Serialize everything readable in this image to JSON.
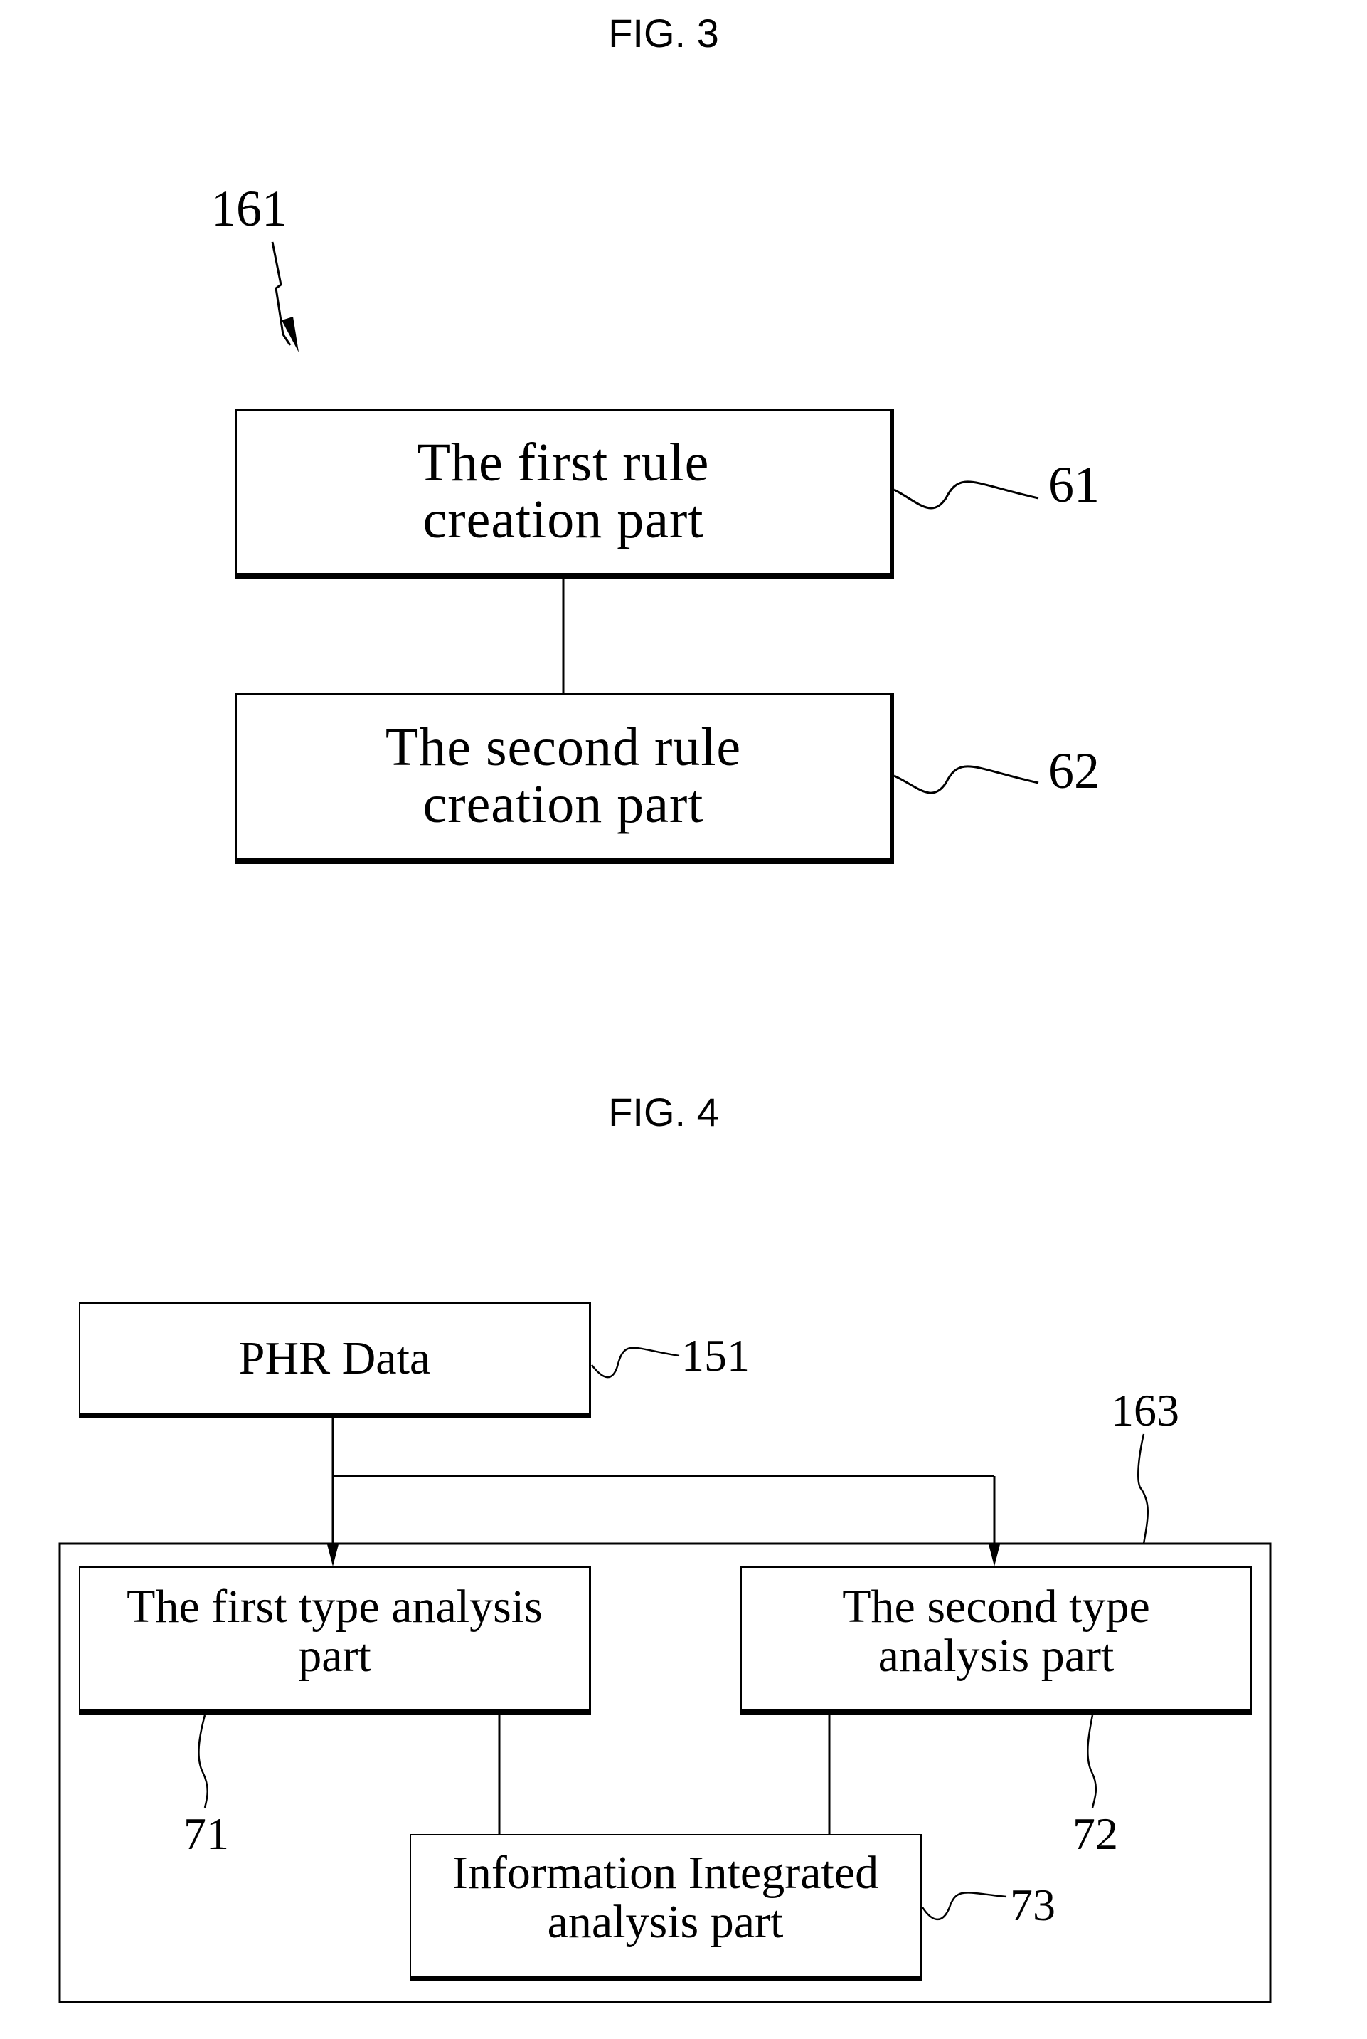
{
  "fig3": {
    "title": "FIG. 3",
    "ref_main": "161",
    "box1": {
      "line1": "The first rule",
      "line2": "creation part",
      "ref": "61"
    },
    "box2": {
      "line1": "The second rule",
      "line2": "creation part",
      "ref": "62"
    }
  },
  "fig4": {
    "title": "FIG. 4",
    "phr": {
      "label": "PHR Data",
      "ref": "151"
    },
    "group_ref": "163",
    "box71": {
      "line1": "The first type analysis",
      "line2": "part",
      "ref": "71"
    },
    "box72": {
      "line1": "The second type",
      "line2": "analysis part",
      "ref": "72"
    },
    "box73": {
      "line1": "Information Integrated",
      "line2": "analysis part",
      "ref": "73"
    }
  }
}
